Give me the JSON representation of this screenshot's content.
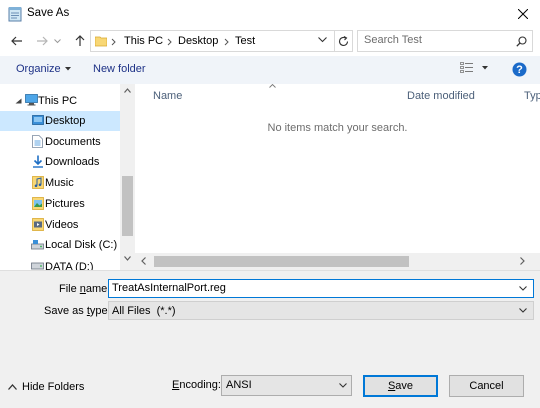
{
  "window": {
    "title": "Save As",
    "close_glyph": "✕"
  },
  "address_bar": {
    "breadcrumbs": [
      "This PC",
      "Desktop",
      "Test"
    ],
    "refresh_icon": "refresh-icon"
  },
  "search": {
    "placeholder": "Search Test"
  },
  "commandbar": {
    "organize_label": "Organize",
    "new_folder_label": "New folder",
    "help_glyph": "?"
  },
  "nav_pane": {
    "items": [
      {
        "label": "This PC",
        "icon": "pc-icon"
      },
      {
        "label": "Desktop",
        "icon": "desktop-folder-icon",
        "selected": true
      },
      {
        "label": "Documents",
        "icon": "documents-icon"
      },
      {
        "label": "Downloads",
        "icon": "downloads-icon"
      },
      {
        "label": "Music",
        "icon": "music-icon"
      },
      {
        "label": "Pictures",
        "icon": "pictures-icon"
      },
      {
        "label": "Videos",
        "icon": "videos-icon"
      },
      {
        "label": "Local Disk (C:)",
        "icon": "drive-icon"
      },
      {
        "label": "DATA (D:)",
        "icon": "drive-icon"
      }
    ]
  },
  "file_list": {
    "columns": [
      "Name",
      "Date modified",
      "Typ"
    ],
    "empty_message": "No items match your search."
  },
  "form": {
    "file_name_label_pre": "File ",
    "file_name_label_u": "n",
    "file_name_label_post": "ame:",
    "file_name_value": "TreatAsInternalPort.reg",
    "save_as_type_label_pre": "Save as ",
    "save_as_type_label_u": "t",
    "save_as_type_label_post": "ype:",
    "save_as_type_value": "All Files  (*.*)"
  },
  "footer": {
    "hide_folders_label": "Hide Folders",
    "encoding_label_pre": "",
    "encoding_label_u": "E",
    "encoding_label_post": "ncoding:",
    "encoding_value": "ANSI",
    "save_label_u": "S",
    "save_label_post": "ave",
    "cancel_label": "Cancel"
  }
}
